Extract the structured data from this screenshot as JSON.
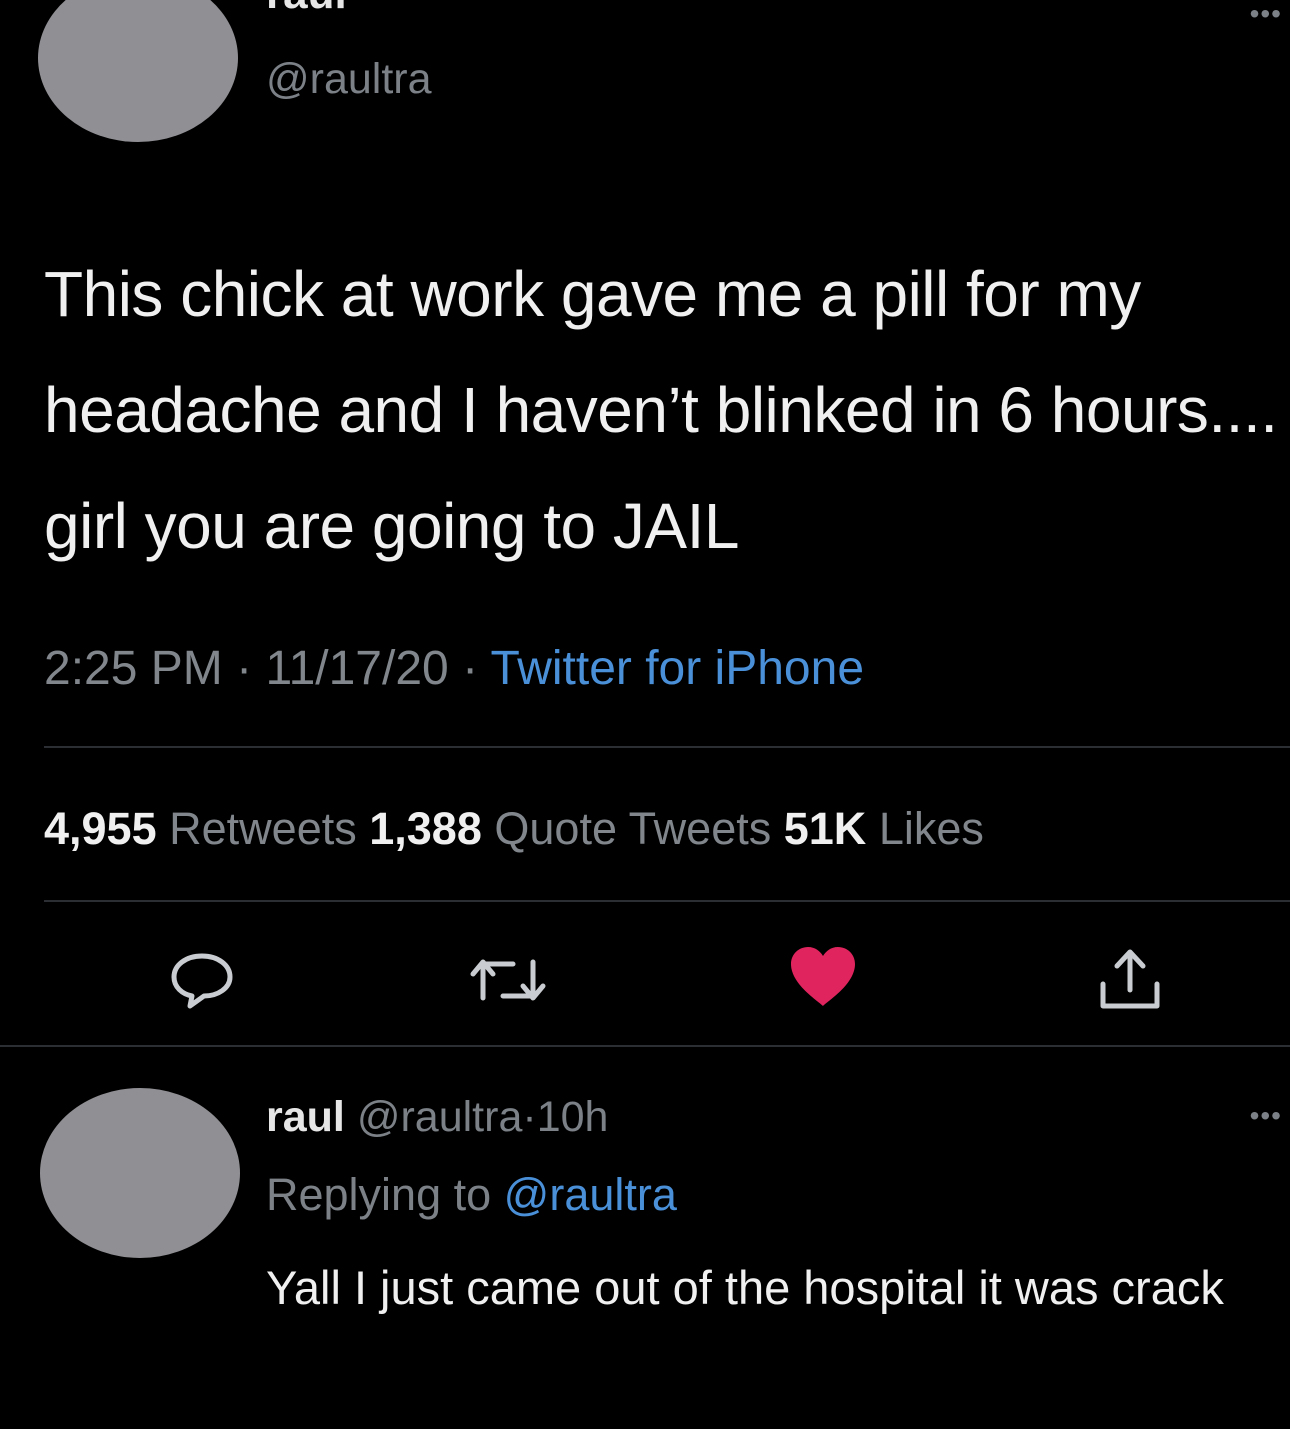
{
  "main_tweet": {
    "display_name": "raul",
    "handle": "@raultra",
    "more_icon": "more-dots-icon",
    "text": "This chick at work gave me a pill for my headache and I haven’t blinked in 6 hours.... girl you are going to JAIL",
    "time": "2:25 PM",
    "date": "11/17/20",
    "separator": "·",
    "source": "Twitter for iPhone",
    "stats": {
      "retweets_count": "4,955",
      "retweets_label": "Retweets",
      "quote_count": "1,388",
      "quote_label": "Quote Tweets",
      "likes_count": "51K",
      "likes_label": "Likes"
    },
    "actions": {
      "reply_icon": "speech-bubble-icon",
      "retweet_icon": "retweet-icon",
      "like_icon": "heart-icon",
      "share_icon": "share-icon"
    }
  },
  "reply_tweet": {
    "display_name": "raul",
    "handle": "@raultra",
    "separator": "·",
    "age": "10h",
    "replying_prefix": "Replying to",
    "replying_handle": "@raultra",
    "text": "Yall I just came out of the hospital it was crack",
    "more_icon": "more-dots-icon"
  },
  "colors": {
    "background": "#000000",
    "text_primary": "#f0f0f0",
    "text_secondary": "#80868b",
    "link_blue": "#4a90d9",
    "like_pink": "#e0245e",
    "avatar_gray": "#8f8f94",
    "divider": "#2b2f33"
  }
}
